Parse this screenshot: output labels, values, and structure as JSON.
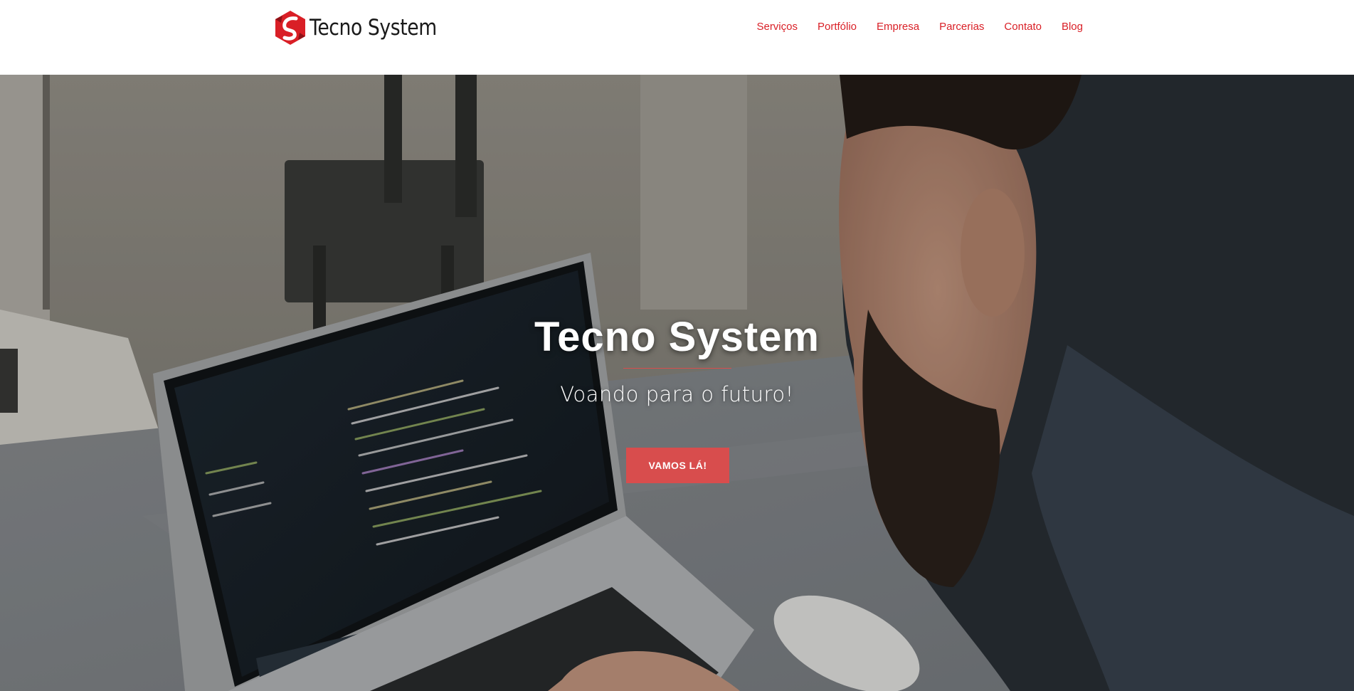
{
  "brand": {
    "name": "Tecno System",
    "accent_color": "#d91f26",
    "logo_icon": "tecno-system-logo-icon"
  },
  "nav": {
    "items": [
      {
        "label": "Serviços"
      },
      {
        "label": "Portfólio"
      },
      {
        "label": "Empresa"
      },
      {
        "label": "Parcerias"
      },
      {
        "label": "Contato"
      },
      {
        "label": "Blog"
      }
    ]
  },
  "hero": {
    "title": "Tecno System",
    "subtitle": "Voando para o futuro!",
    "cta_label": "VAMOS LÁ!",
    "cta_color": "#d84d4d",
    "background": "photo-developer-coding-on-laptop"
  }
}
